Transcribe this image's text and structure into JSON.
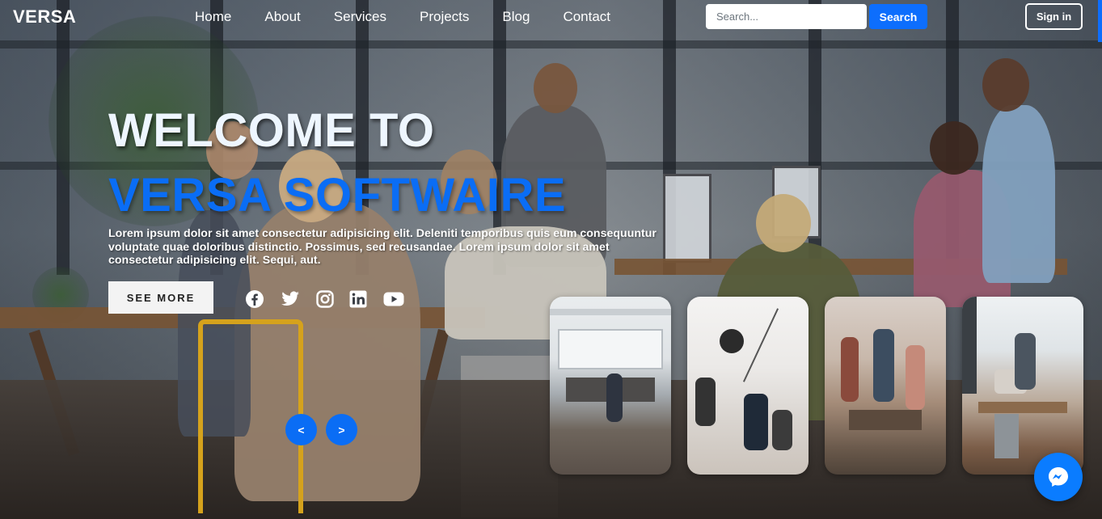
{
  "brand": "VERSA",
  "nav": {
    "links": [
      "Home",
      "About",
      "Services",
      "Projects",
      "Blog",
      "Contact"
    ],
    "search_placeholder": "Search...",
    "search_button": "Search",
    "signin_button": "Sign in"
  },
  "hero": {
    "title_line1": "WELCOME TO",
    "title_line2": "VERSA SOFTWAIRE",
    "description": "Lorem ipsum dolor sit amet consectetur adipisicing elit. Deleniti temporibus quis eum consequuntur voluptate quae doloribus distinctio. Possimus, sed recusandae. Lorem ipsum dolor sit amet consectetur adipisicing elit. Sequi, aut.",
    "cta_label": "SEE MORE",
    "social_icons": [
      "facebook-icon",
      "twitter-icon",
      "instagram-icon",
      "linkedin-icon",
      "youtube-icon"
    ]
  },
  "carousel": {
    "prev_label": "<",
    "next_label": ">"
  },
  "thumbnails": [
    "office-photo",
    "team-overhead-photo",
    "team-high-five-photo",
    "coworking-photo"
  ],
  "colors": {
    "accent": "#0a6df5",
    "search_button": "#0d6efd",
    "messenger": "#0a7cff"
  },
  "chat_icon": "messenger-icon"
}
